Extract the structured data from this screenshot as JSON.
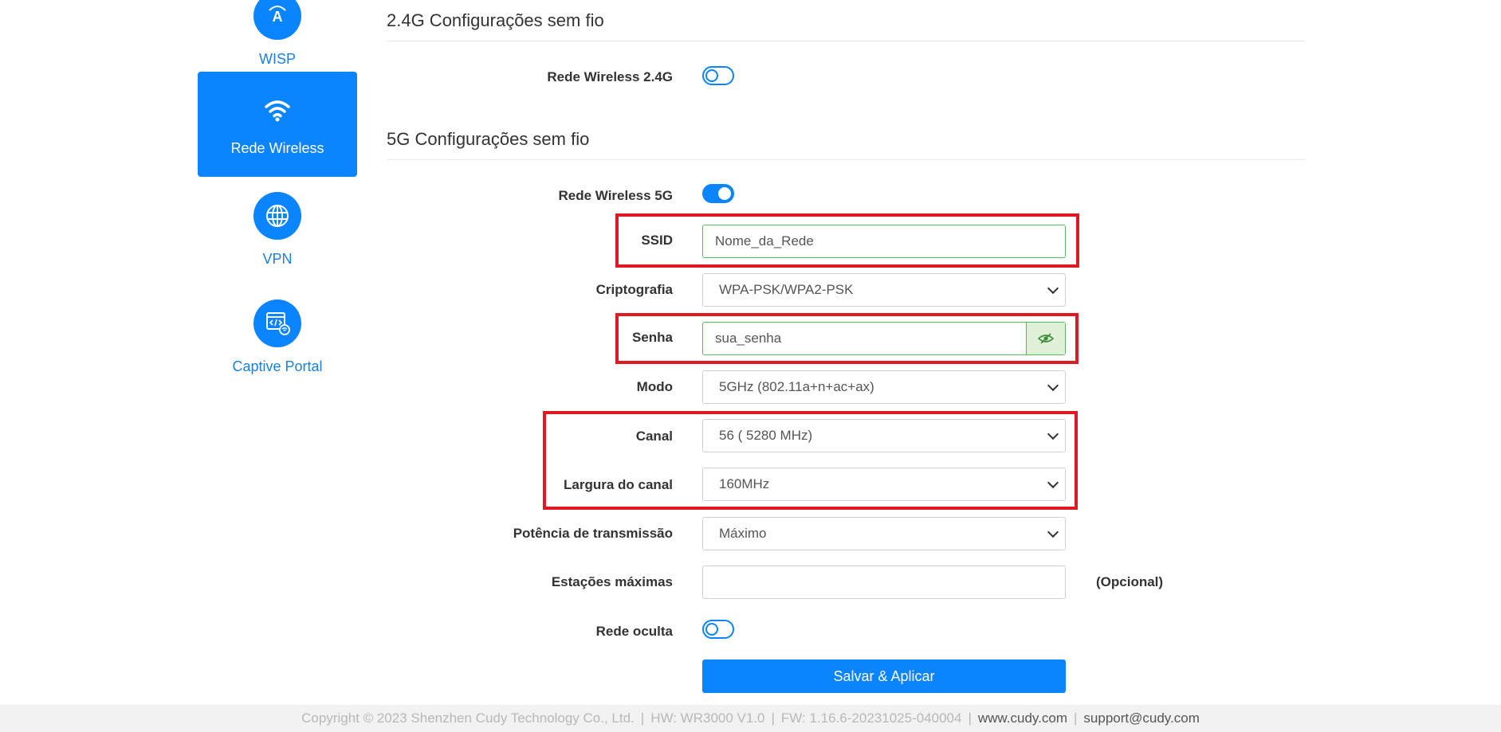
{
  "sidebar": {
    "items": [
      {
        "label": "WISP",
        "icon": "wisp-icon"
      },
      {
        "label": "Rede Wireless",
        "icon": "wifi-icon",
        "active": true
      },
      {
        "label": "VPN",
        "icon": "globe-icon"
      },
      {
        "label": "Captive Portal",
        "icon": "captive-portal-icon"
      }
    ]
  },
  "section24": {
    "title": "2.4G Configurações sem fio",
    "wireless_label": "Rede Wireless 2.4G",
    "wireless_enabled": false
  },
  "section5": {
    "title": "5G Configurações sem fio",
    "wireless_label": "Rede Wireless 5G",
    "wireless_enabled": true,
    "ssid_label": "SSID",
    "ssid_value": "Nome_da_Rede",
    "crypto_label": "Criptografia",
    "crypto_value": "WPA-PSK/WPA2-PSK",
    "password_label": "Senha",
    "password_value": "sua_senha",
    "mode_label": "Modo",
    "mode_value": "5GHz (802.11a+n+ac+ax)",
    "channel_label": "Canal",
    "channel_value": "56 ( 5280 MHz)",
    "width_label": "Largura do canal",
    "width_value": "160MHz",
    "power_label": "Potência de transmissão",
    "power_value": "Máximo",
    "max_stations_label": "Estações máximas",
    "max_stations_value": "",
    "optional_label": "(Opcional)",
    "hidden_label": "Rede oculta",
    "hidden_enabled": false,
    "save_label": "Salvar & Aplicar"
  },
  "footer": {
    "copyright": "Copyright © 2023 Shenzhen Cudy Technology Co., Ltd.",
    "hw": "HW: WR3000 V1.0",
    "fw": "FW: 1.16.6-20231025-040004",
    "website": "www.cudy.com",
    "support": "support@cudy.com",
    "separator": "|"
  },
  "colors": {
    "accent": "#0a84ff",
    "highlight": "#e01a22",
    "valid": "#5cb85c"
  }
}
